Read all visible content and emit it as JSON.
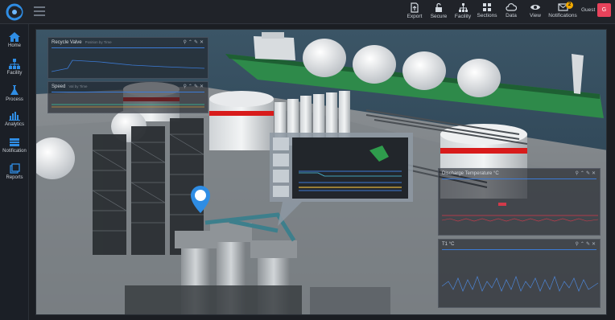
{
  "toolbar": {
    "export_label": "Export",
    "secure_label": "Secure",
    "facility_label": "Facility",
    "sections_label": "Sections",
    "data_label": "Data",
    "view_label": "View",
    "notifications_label": "Notifications",
    "notifications_count": "2"
  },
  "user": {
    "name": "Guest",
    "avatar_letter": "G"
  },
  "sidebar": {
    "items": [
      {
        "label": "Home",
        "icon": "home-icon"
      },
      {
        "label": "Facility",
        "icon": "facility-icon"
      },
      {
        "label": "Process",
        "icon": "flask-icon"
      },
      {
        "label": "Analytics",
        "icon": "bar-chart-icon"
      },
      {
        "label": "Notification",
        "icon": "notification-icon"
      },
      {
        "label": "Reports",
        "icon": "reports-icon"
      }
    ]
  },
  "panels": {
    "recycle": {
      "title": "Recycle Valve",
      "subtitle": "Position by Time"
    },
    "speed": {
      "title": "Speed",
      "subtitle": "Val by Time"
    },
    "discharge": {
      "title": "Discharge Temperature °C"
    },
    "t1": {
      "title": "T1 °C"
    }
  },
  "colors": {
    "accent": "#2f8de4",
    "notification_badge": "#f0a800",
    "avatar": "#e8425b",
    "tank_stripe": "#d81b1b",
    "ship_hull": "#2e8a4a"
  }
}
